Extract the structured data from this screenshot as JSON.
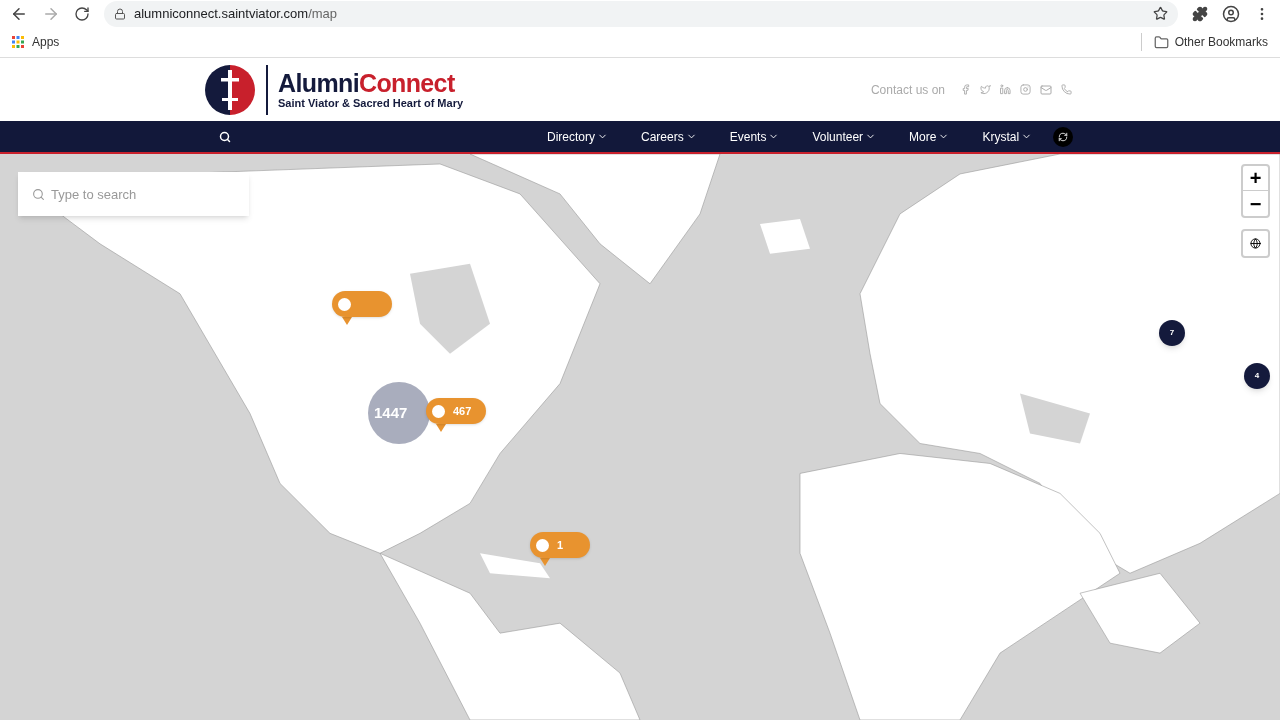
{
  "browser": {
    "url_host": "alumniconnect.saintviator.com",
    "url_path": "/map",
    "bookmarks": [
      "Apps"
    ],
    "other_bookmarks": "Other Bookmarks"
  },
  "header": {
    "logo_title_a": "Alumni",
    "logo_title_b": "Connect",
    "logo_subtitle": "Saint Viator & Sacred Heart of Mary",
    "contact_label": "Contact us on"
  },
  "nav": {
    "items": [
      "Directory",
      "Careers",
      "Events",
      "Volunteer",
      "More",
      "Krystal"
    ]
  },
  "map": {
    "search": {
      "placeholder": "Type to search"
    },
    "zoom_in": "+",
    "zoom_out": "−",
    "markers": [
      {
        "kind": "pin"
      },
      {
        "kind": "halo",
        "label": "1447"
      },
      {
        "kind": "pin",
        "label": "467"
      },
      {
        "kind": "pin",
        "label": "1"
      },
      {
        "kind": "cluster",
        "label": "7"
      },
      {
        "kind": "cluster",
        "label": "4"
      }
    ]
  }
}
